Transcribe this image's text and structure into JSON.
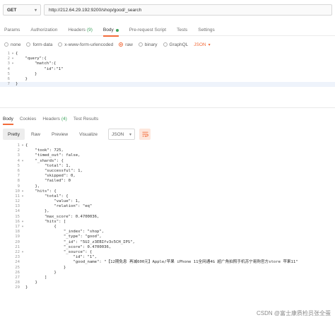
{
  "request": {
    "method": "GET",
    "url": "http://212.64.29.192:9200/shop/good/_search"
  },
  "request_tabs": [
    {
      "label": "Params"
    },
    {
      "label": "Authorization"
    },
    {
      "label": "Headers",
      "count": "(9)"
    },
    {
      "label": "Body"
    },
    {
      "label": "Pre-request Script"
    },
    {
      "label": "Tests"
    },
    {
      "label": "Settings"
    }
  ],
  "body_types": [
    "none",
    "form-data",
    "x-www-form-urlencoded",
    "raw",
    "binary",
    "GraphQL"
  ],
  "body_format": "JSON",
  "request_body": [
    {
      "n": "1",
      "fold": "▾",
      "text": "{"
    },
    {
      "n": "2",
      "fold": "▾",
      "text": "    \"query\":{"
    },
    {
      "n": "3",
      "fold": "▾",
      "text": "        \"match\":{"
    },
    {
      "n": "4",
      "fold": "",
      "text": "            \"id\":\"1\""
    },
    {
      "n": "5",
      "fold": "",
      "text": "        }"
    },
    {
      "n": "6",
      "fold": "",
      "text": "    }"
    },
    {
      "n": "7",
      "fold": "",
      "text": "}"
    }
  ],
  "response_tabs": [
    {
      "label": "Body"
    },
    {
      "label": "Cookies"
    },
    {
      "label": "Headers",
      "count": "(4)"
    },
    {
      "label": "Test Results"
    }
  ],
  "view_modes": [
    "Pretty",
    "Raw",
    "Preview",
    "Visualize"
  ],
  "response_format": "JSON",
  "response_body": [
    {
      "n": "1",
      "fold": "▾",
      "text": "{"
    },
    {
      "n": "2",
      "fold": "",
      "text": "    \"took\": 725,"
    },
    {
      "n": "3",
      "fold": "",
      "text": "    \"timed_out\": false,"
    },
    {
      "n": "4",
      "fold": "▾",
      "text": "    \"_shards\": {"
    },
    {
      "n": "5",
      "fold": "",
      "text": "        \"total\": 1,"
    },
    {
      "n": "6",
      "fold": "",
      "text": "        \"successful\": 1,"
    },
    {
      "n": "7",
      "fold": "",
      "text": "        \"skipped\": 0,"
    },
    {
      "n": "8",
      "fold": "",
      "text": "        \"failed\": 0"
    },
    {
      "n": "9",
      "fold": "",
      "text": "    },"
    },
    {
      "n": "10",
      "fold": "▾",
      "text": "    \"hits\": {"
    },
    {
      "n": "11",
      "fold": "▾",
      "text": "        \"total\": {"
    },
    {
      "n": "12",
      "fold": "",
      "text": "            \"value\": 1,"
    },
    {
      "n": "13",
      "fold": "",
      "text": "            \"relation\": \"eq\""
    },
    {
      "n": "14",
      "fold": "",
      "text": "        },"
    },
    {
      "n": "15",
      "fold": "",
      "text": "        \"max_score\": 0.4700036,"
    },
    {
      "n": "16",
      "fold": "▾",
      "text": "        \"hits\": ["
    },
    {
      "n": "17",
      "fold": "▾",
      "text": "            {"
    },
    {
      "n": "18",
      "fold": "",
      "text": "                \"_index\": \"shop\","
    },
    {
      "n": "19",
      "fold": "",
      "text": "                \"_type\": \"good\","
    },
    {
      "n": "20",
      "fold": "",
      "text": "                \"_id\": \"5UJ_z3EBIfv3c5CH_IPS\","
    },
    {
      "n": "21",
      "fold": "",
      "text": "                \"_score\": 0.4700036,"
    },
    {
      "n": "22",
      "fold": "▾",
      "text": "                \"_source\": {"
    },
    {
      "n": "23",
      "fold": "",
      "text": "                    \"id\": \"1\","
    },
    {
      "n": "24",
      "fold": "",
      "text": "                    \"good_name\": \"【12期免息 再减600元】Apple/苹果 iPhone 11全网通4G 超广角拍照手机苏宁易购官方store 苹果11\""
    },
    {
      "n": "25",
      "fold": "",
      "text": "                }"
    },
    {
      "n": "26",
      "fold": "",
      "text": "            }"
    },
    {
      "n": "27",
      "fold": "",
      "text": "        ]"
    },
    {
      "n": "28",
      "fold": "",
      "text": "    }"
    },
    {
      "n": "29",
      "fold": "",
      "text": "}"
    }
  ],
  "watermark": "CSDN @富士康质检员张全蛋",
  "colors": {
    "accent": "#f26b3a",
    "count": "#3da35d"
  }
}
